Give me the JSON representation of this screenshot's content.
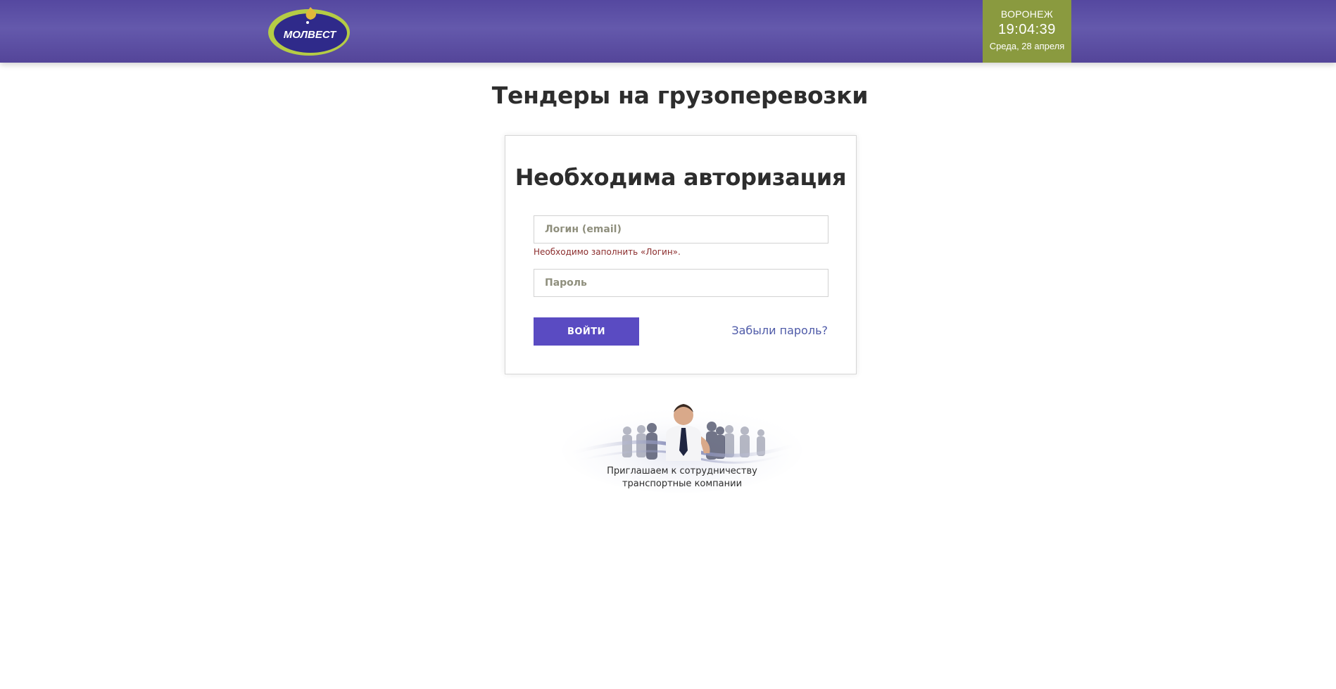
{
  "header": {
    "logo_text": "МОЛВЕСТ",
    "clock": {
      "city": "ВОРОНЕЖ",
      "time": "19:04:39",
      "date": "Среда, 28 апреля"
    }
  },
  "page": {
    "title": "Тендеры на грузоперевозки"
  },
  "auth": {
    "title": "Необходима авторизация",
    "login": {
      "value": "",
      "placeholder": "Логин (email)"
    },
    "login_error": "Необходимо заполнить «Логин».",
    "password": {
      "value": "",
      "placeholder": "Пароль"
    },
    "submit_label": "ВОЙТИ",
    "forgot_label": "Забыли пароль?"
  },
  "promo": {
    "line1": "Приглашаем к сотрудничеству",
    "line2": "транспортные компании"
  },
  "colors": {
    "header_purple": "#5e52a8",
    "clock_green": "#8a9a3f",
    "button_purple": "#5a4bc2",
    "link_blue": "#4e5aa8",
    "error_red": "#8b2c2c",
    "logo_ring": "#b5cc45"
  },
  "icons": [
    "molvest-logo",
    "business-team-image"
  ]
}
